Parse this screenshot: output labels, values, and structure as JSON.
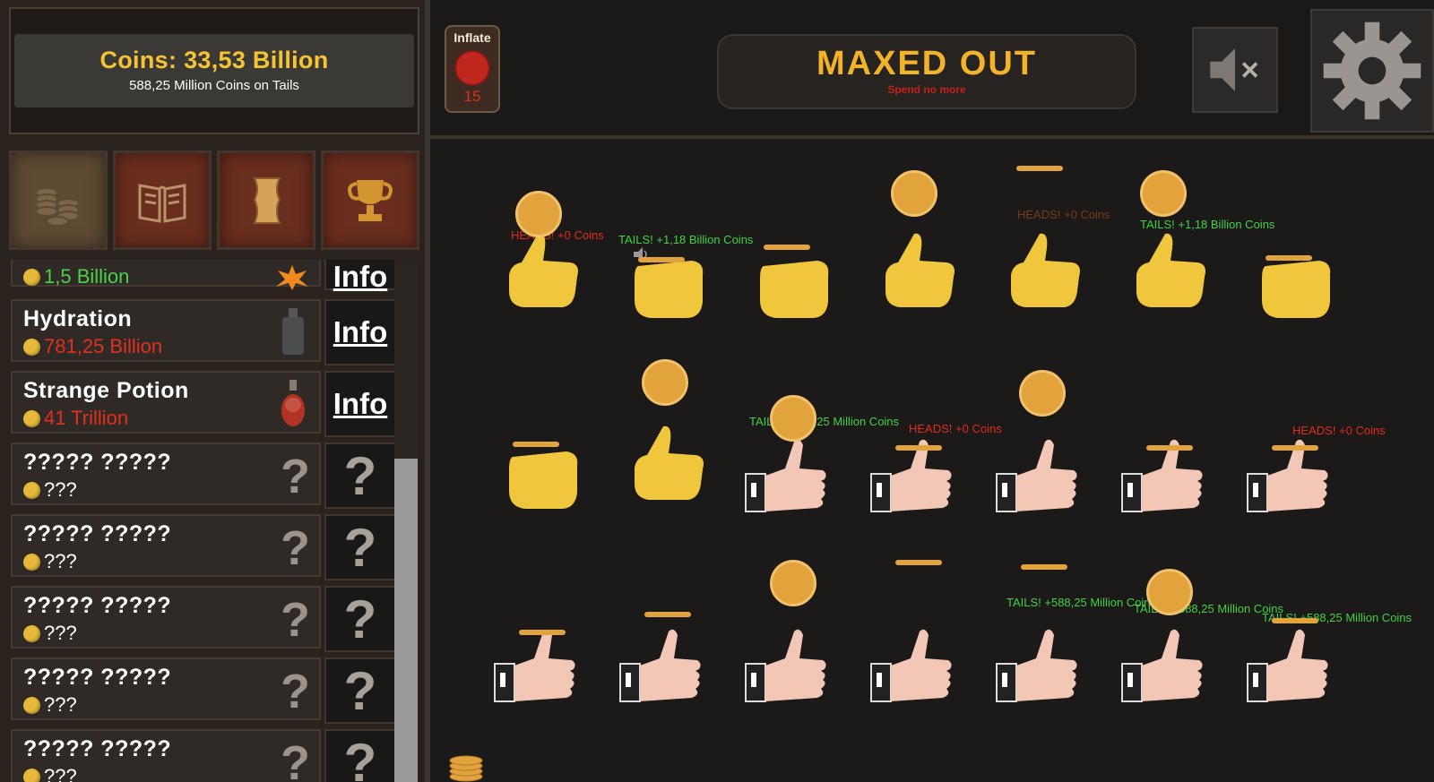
{
  "header": {
    "coins_label": "Coins: 33,53 Billion",
    "coins_on_tails": "588,25 Million Coins on Tails"
  },
  "tabs": [
    {
      "name": "coins-tab",
      "icon": "coin-stack-icon"
    },
    {
      "name": "book-tab",
      "icon": "book-icon"
    },
    {
      "name": "scroll-tab",
      "icon": "scroll-icon"
    },
    {
      "name": "trophy-tab",
      "icon": "trophy-icon"
    }
  ],
  "shop": {
    "items": [
      {
        "name": "",
        "price": "1,5 Billion",
        "price_color": "green",
        "button": "Info"
      },
      {
        "name": "Hydration",
        "price": "781,25 Billion",
        "price_color": "red",
        "button": "Info"
      },
      {
        "name": "Strange Potion",
        "price": "41 Trillion",
        "price_color": "red",
        "button": "Info"
      },
      {
        "name": "????? ?????",
        "price": "???",
        "price_color": "white",
        "button": "?"
      },
      {
        "name": "????? ?????",
        "price": "???",
        "price_color": "white",
        "button": "?"
      },
      {
        "name": "????? ?????",
        "price": "???",
        "price_color": "white",
        "button": "?"
      },
      {
        "name": "????? ?????",
        "price": "???",
        "price_color": "white",
        "button": "?"
      },
      {
        "name": "????? ?????",
        "price": "???",
        "price_color": "white",
        "button": "?"
      }
    ],
    "partial_top_button": "Info"
  },
  "topbar": {
    "inflate_label": "Inflate",
    "inflate_count": "15",
    "maxed_title": "MAXED OUT",
    "maxed_sub": "Spend no more"
  },
  "floats": {
    "f1": "HEADS! +0 Coins",
    "f2": "TAILS! +1,18 Billion Coins",
    "f3": "HEADS! +0 Coins",
    "f4": "TAILS! +1,18 Billion Coins",
    "f5": "TAILS! +588,25 Million Coins",
    "f6": "HEADS! +0 Coins",
    "f7": "HEADS! +0 Coins",
    "f8": "TAILS! +588,25 Million Coins",
    "f9": "TAILS! +588,25 Million Coins",
    "f10": "TAILS! +588,25 Million Coins"
  },
  "colors": {
    "gold": "#f6c433",
    "red": "#e22f1f",
    "green": "#40d044",
    "thumb_yellow": "#f0c63c",
    "thumb_skin": "#f2c7b6"
  }
}
